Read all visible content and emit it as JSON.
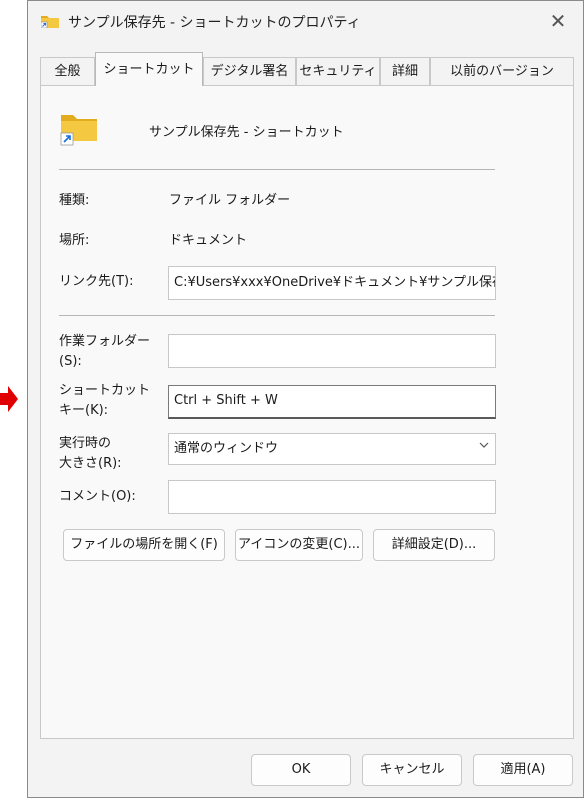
{
  "window": {
    "title": "サンプル保存先 - ショートカットのプロパティ",
    "close_glyph": "✕"
  },
  "tabs": [
    {
      "label": "全般"
    },
    {
      "label": "ショートカット"
    },
    {
      "label": "デジタル署名"
    },
    {
      "label": "セキュリティ"
    },
    {
      "label": "詳細"
    },
    {
      "label": "以前のバージョン"
    }
  ],
  "active_tab": "ショートカット",
  "shortcut_name": "サンプル保存先 - ショートカット",
  "fields": {
    "type_label": "種類:",
    "type_value": "ファイル フォルダー",
    "location_label": "場所:",
    "location_value": "ドキュメント",
    "target_label": "リンク先(T):",
    "target_value": "C:¥Users¥xxx¥OneDrive¥ドキュメント¥サンプル保存先",
    "workdir_label_1": "作業フォルダー",
    "workdir_label_2": "(S):",
    "workdir_value": "",
    "hotkey_label_1": "ショートカット",
    "hotkey_label_2": "キー(K):",
    "hotkey_value": "Ctrl + Shift + W",
    "run_label_1": "実行時の",
    "run_label_2": "大きさ(R):",
    "run_value": "通常のウィンドウ",
    "comment_label": "コメント(O):",
    "comment_value": ""
  },
  "buttons": {
    "open_location": "ファイルの場所を開く(F)",
    "change_icon": "アイコンの変更(C)...",
    "advanced": "詳細設定(D)...",
    "ok": "OK",
    "cancel": "キャンセル",
    "apply": "適用(A)"
  },
  "colors": {
    "folder": "#f5c842",
    "folder_dark": "#e3ac1e",
    "arrow_red": "#e00000",
    "shortcut_arrow": "#1a6fd4"
  }
}
